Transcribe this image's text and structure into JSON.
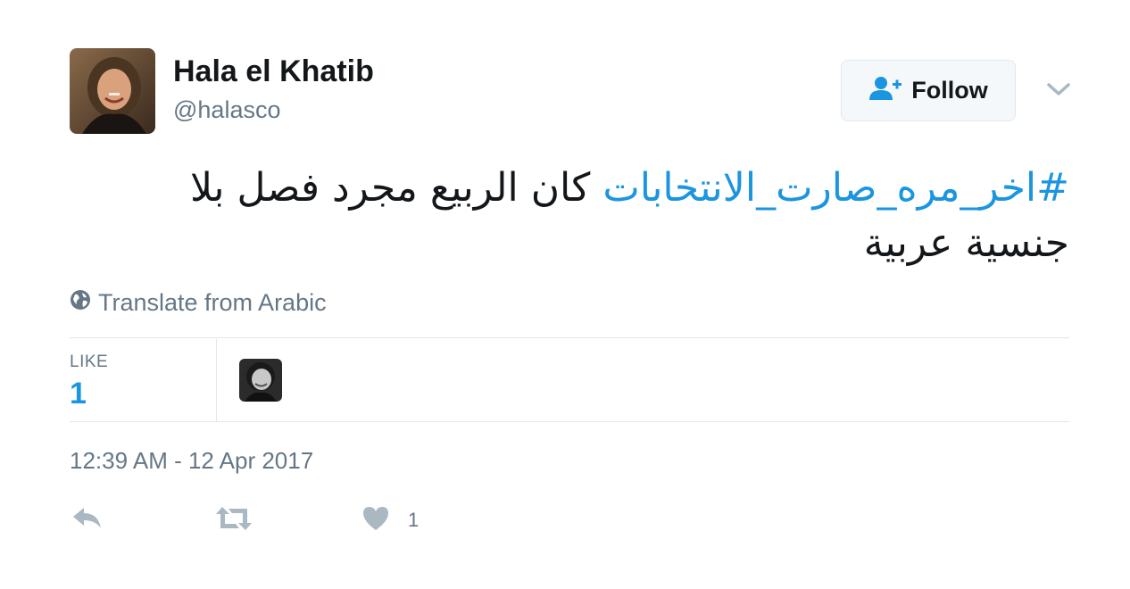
{
  "user": {
    "display_name": "Hala el Khatib",
    "handle": "@halasco"
  },
  "follow_button": {
    "label": "Follow"
  },
  "tweet": {
    "hashtag": "#اخر_مره_صارت_الانتخابات",
    "text": " كان الربيع مجرد فصل بلا جنسية عربية"
  },
  "translate": {
    "label": "Translate from Arabic"
  },
  "stats": {
    "like_label": "LIKE",
    "like_count": "1"
  },
  "timestamp": "12:39 AM - 12 Apr 2017",
  "actions": {
    "like_count": "1"
  },
  "colors": {
    "link": "#1b95e0",
    "muted": "#657786",
    "icon": "#aab8c2",
    "border": "#e1e8ed"
  },
  "icons": {
    "follow": "follow-person-plus-icon",
    "menu": "chevron-down-icon",
    "translate": "globe-icon",
    "reply": "reply-icon",
    "retweet": "retweet-icon",
    "like": "heart-icon"
  }
}
